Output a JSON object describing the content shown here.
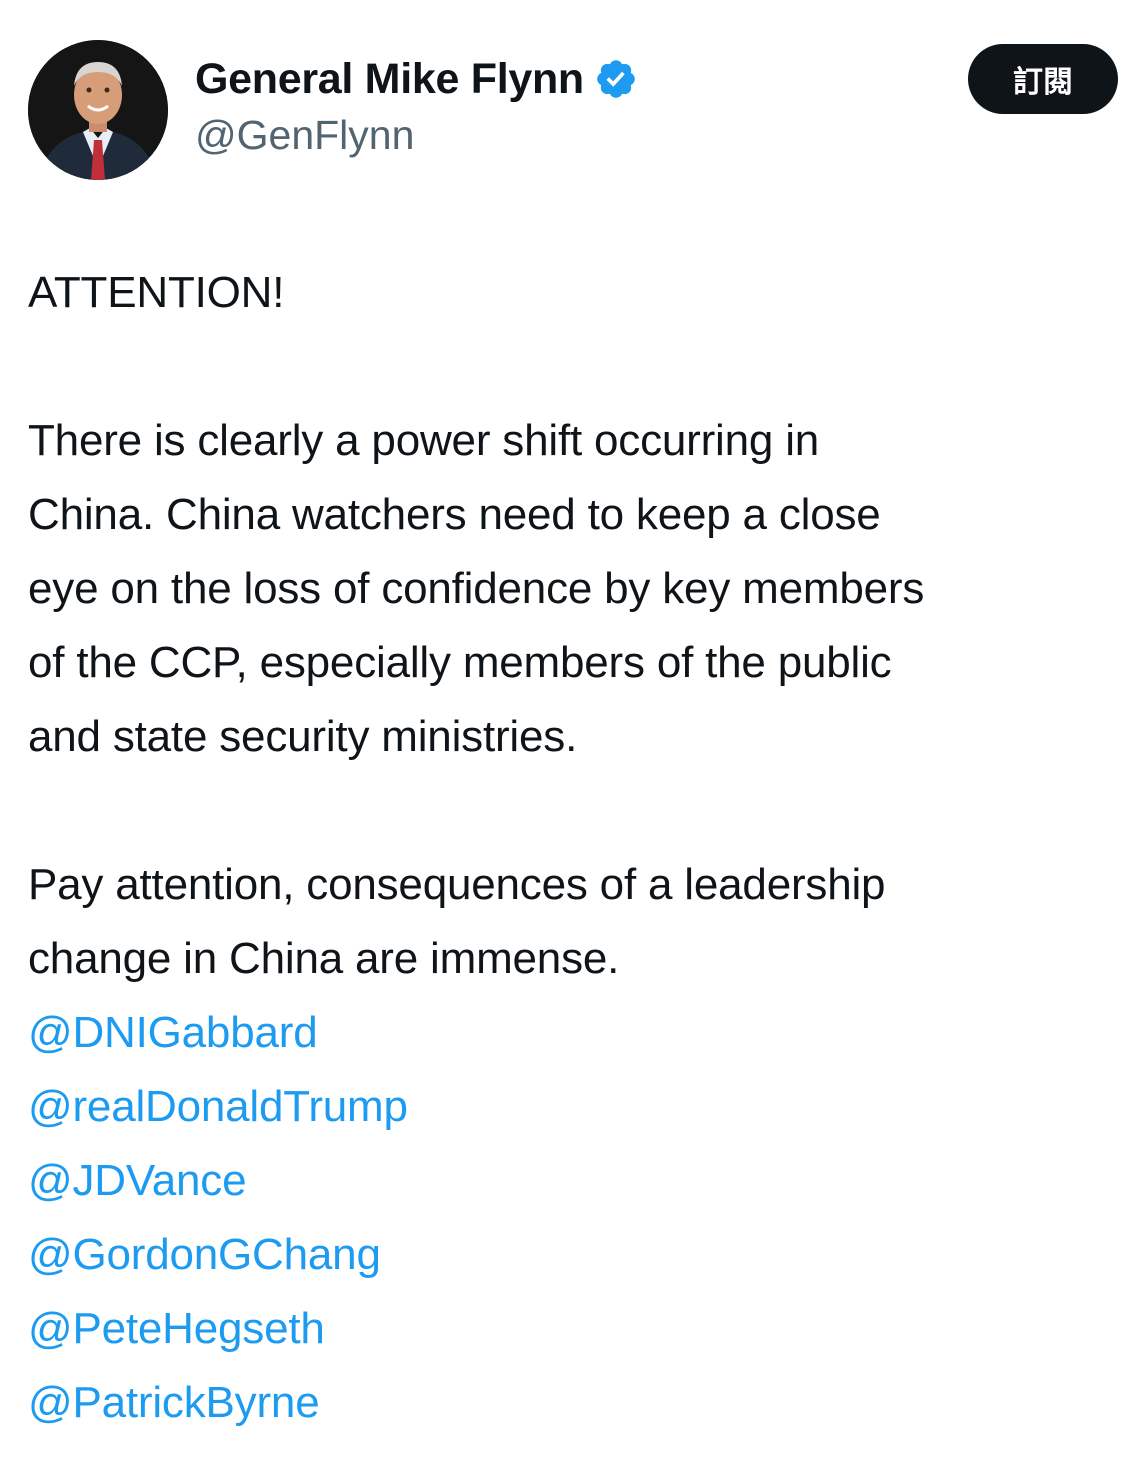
{
  "author": {
    "display_name": "General Mike Flynn",
    "handle": "@GenFlynn",
    "verified": true,
    "avatar_icon": "profile-photo"
  },
  "subscribe_label": "訂閱",
  "colors": {
    "text": "#0f1419",
    "secondary": "#536471",
    "link": "#1d9bf0",
    "verified_badge": "#1d9bf0",
    "button_bg": "#0f1419"
  },
  "tweet": {
    "heading": "ATTENTION!",
    "paragraph1_lines": [
      "There is clearly a power shift occurring in",
      "China. China watchers need to keep a close",
      "eye on the loss of confidence by key members",
      "of the CCP, especially members of the public",
      "and state security ministries."
    ],
    "paragraph2_lines": [
      "Pay attention, consequences of a leadership",
      "change in China are immense."
    ],
    "mentions": [
      "@DNIGabbard",
      "@realDonaldTrump",
      "@JDVance",
      "@GordonGChang",
      "@PeteHegseth",
      "@PatrickByrne"
    ]
  }
}
